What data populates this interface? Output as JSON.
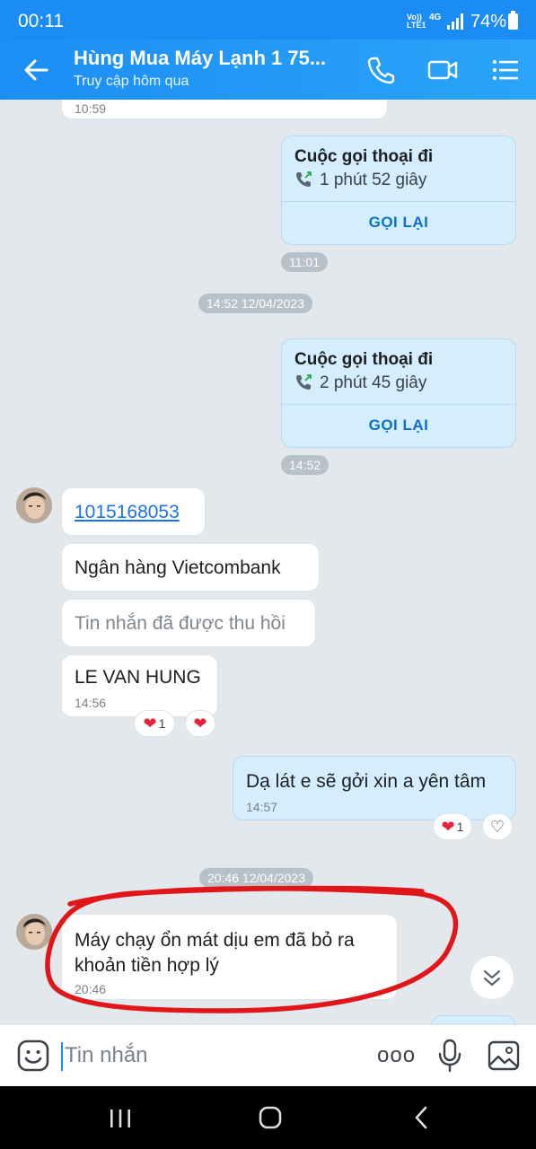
{
  "status_bar": {
    "time": "00:11",
    "network_top": "Vo))",
    "network_bottom": "LTE1",
    "network_type": "4G",
    "battery": "74%"
  },
  "header": {
    "title": "Hùng Mua Máy Lạnh 1 75...",
    "subtitle": "Truy cập hôm qua",
    "icons": [
      "back-arrow-icon",
      "phone-icon",
      "video-icon",
      "menu-icon"
    ]
  },
  "messages": {
    "m0_time": "10:59",
    "call1": {
      "title": "Cuộc gọi thoại đi",
      "duration": "1 phút 52 giây",
      "callback": "GỌI LẠI",
      "time": "11:01"
    },
    "sep1": "14:52 12/04/2023",
    "call2": {
      "title": "Cuộc gọi thoại đi",
      "duration": "2 phút 45 giây",
      "callback": "GỌI LẠI",
      "time": "14:52"
    },
    "account": "1015168053",
    "bank": "Ngân hàng Vietcombank",
    "recalled": "Tin nhắn đã được thu hồi",
    "name": {
      "text": "LE VAN HUNG",
      "time": "14:56",
      "react_count": "1"
    },
    "sent1": {
      "text": "Dạ lát e sẽ gởi xin a yên tâm",
      "time": "14:57",
      "react_count": "1"
    },
    "sep2": "20:46 12/04/2023",
    "last": {
      "line1": "Máy chạy ổn mát dịu em đã bỏ ra",
      "line2": "khoản tiền hợp lý",
      "time": "20:46"
    }
  },
  "input": {
    "placeholder": "Tin nhắn",
    "more": "ooo"
  },
  "colors": {
    "accent": "#1a8cf3",
    "sent_bubble": "#d4eefd",
    "annotation": "#e0161b",
    "heart": "#e8223c"
  }
}
